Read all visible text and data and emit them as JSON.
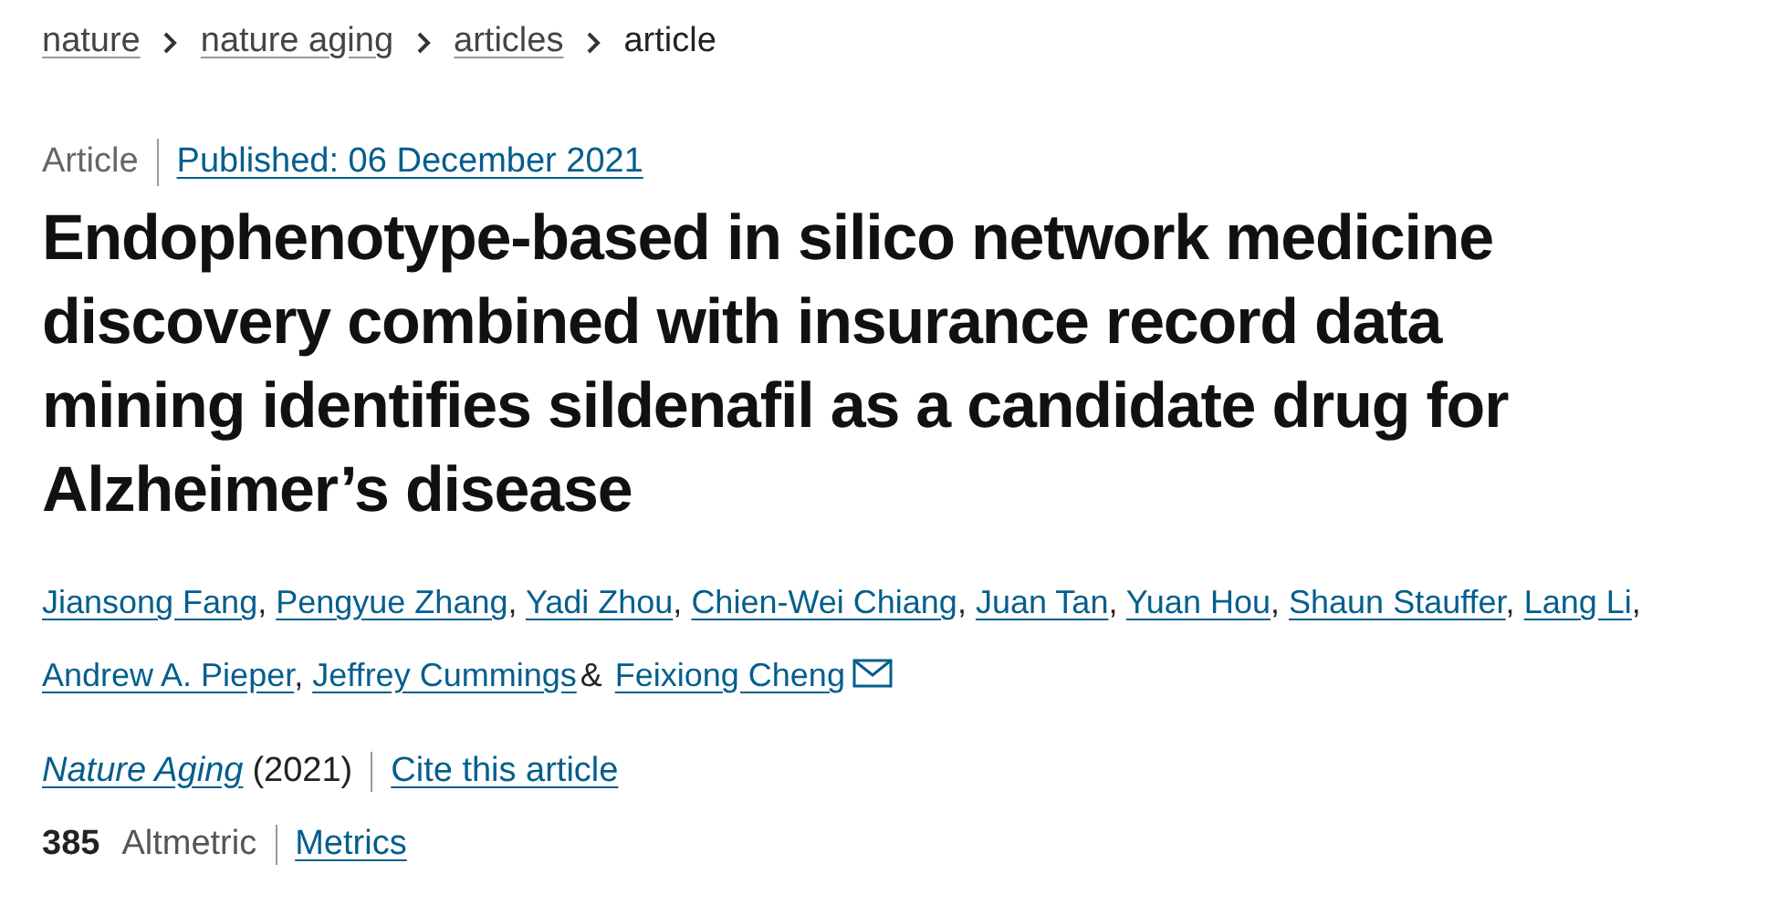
{
  "breadcrumb": [
    {
      "label": "nature",
      "link": true
    },
    {
      "label": "nature aging",
      "link": true
    },
    {
      "label": "articles",
      "link": true
    },
    {
      "label": "article",
      "link": false
    }
  ],
  "article_type": "Article",
  "published": "Published: 06 December 2021",
  "title": "Endophenotype-based in silico network medicine discovery combined with insurance record data mining identifies sildenafil as a candidate drug for Alzheimer’s disease",
  "authors": [
    {
      "name": "Jiansong Fang",
      "separator": ",",
      "contact": false
    },
    {
      "name": "Pengyue Zhang",
      "separator": ",",
      "contact": false
    },
    {
      "name": "Yadi Zhou",
      "separator": ",",
      "contact": false
    },
    {
      "name": "Chien-Wei Chiang",
      "separator": ",",
      "contact": false
    },
    {
      "name": "Juan Tan",
      "separator": ",",
      "contact": false
    },
    {
      "name": "Yuan Hou",
      "separator": ",",
      "contact": false
    },
    {
      "name": "Shaun Stauffer",
      "separator": ",",
      "contact": false
    },
    {
      "name": "Lang Li",
      "separator": ",",
      "contact": false
    },
    {
      "name": "Andrew A. Pieper",
      "separator": ",",
      "contact": false
    },
    {
      "name": "Jeffrey Cummings",
      "separator": "&",
      "contact": false
    },
    {
      "name": "Feixiong Cheng",
      "contact": true
    }
  ],
  "journal": "Nature Aging",
  "year": "(2021)",
  "cite_link": "Cite this article",
  "altmetric_score": "385",
  "altmetric_label": "Altmetric",
  "metrics_link": "Metrics"
}
